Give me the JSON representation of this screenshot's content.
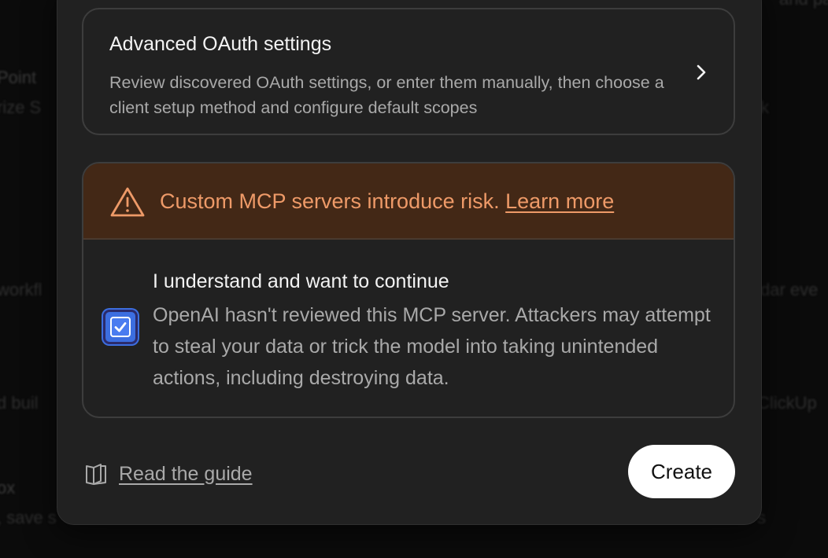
{
  "background": {
    "snippets": [
      "Point",
      "rize S",
      "workfl",
      "d buil",
      "ox",
      ", save s",
      "k",
      "dar eve",
      "ClickUp",
      "s",
      "and pa"
    ]
  },
  "oauth_settings": {
    "title": "Advanced OAuth settings",
    "description": "Review discovered OAuth settings, or enter them manually, then choose a client setup method and configure default scopes",
    "icon": "chevron-right-icon"
  },
  "risk_warning": {
    "text": "Custom MCP servers introduce risk.",
    "link_label": "Learn more",
    "icon": "warning-triangle-icon",
    "color": "#ee9a68",
    "banner_color": "#432816"
  },
  "acknowledgement": {
    "checked": true,
    "title": "I understand and want to continue",
    "description": "OpenAI hasn't reviewed this MCP server. Attackers may attempt to steal your data or trick the model into taking unintended actions, including destroying data.",
    "accent_color": "#3c6ee0"
  },
  "footer": {
    "guide_label": "Read the guide",
    "guide_icon": "book-open-icon",
    "create_label": "Create"
  }
}
